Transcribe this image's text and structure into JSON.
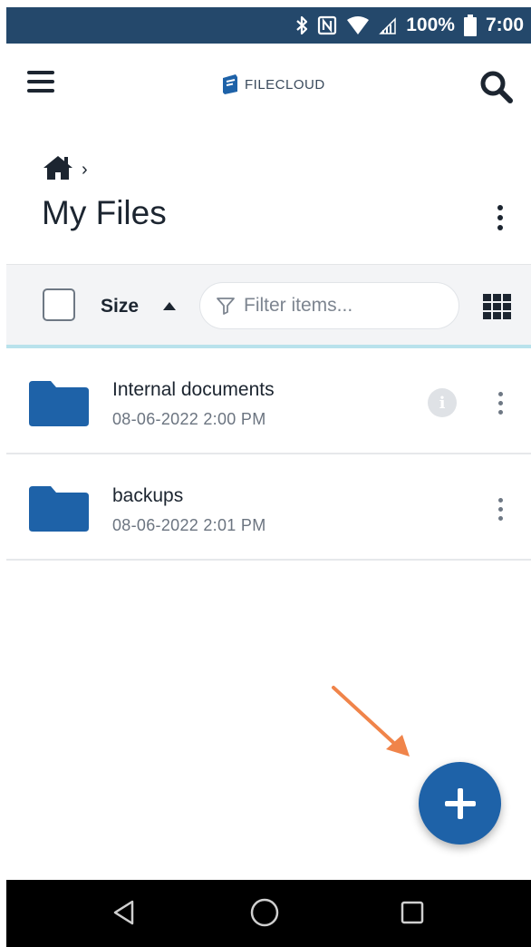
{
  "status_bar": {
    "battery_percent": "100%",
    "time": "7:00",
    "icons": [
      "bluetooth-icon",
      "nfc-icon",
      "wifi-icon",
      "signal-icon",
      "battery-icon"
    ]
  },
  "app_bar": {
    "menu_icon": "hamburger-menu-icon",
    "logo_text": "FILECLOUD",
    "search_icon": "search-icon"
  },
  "breadcrumb": {
    "home_icon": "home-icon",
    "separator": "›"
  },
  "page": {
    "title": "My Files"
  },
  "toolbar": {
    "sort_label": "Size",
    "sort_direction": "ascending",
    "filter_placeholder": "Filter items...",
    "filter_value": "",
    "view_icon": "grid-view-icon"
  },
  "files": [
    {
      "name": "Internal documents",
      "date": "08-06-2022 2:00 PM",
      "type": "folder",
      "has_info": true
    },
    {
      "name": "backups",
      "date": "08-06-2022 2:01 PM",
      "type": "folder",
      "has_info": false
    }
  ],
  "fab": {
    "icon": "plus-icon"
  },
  "navigation_bar": {
    "buttons": [
      "back-icon",
      "home-circle-icon",
      "recents-icon"
    ]
  },
  "colors": {
    "status_bar": "#24486b",
    "accent_blue": "#1e62a8",
    "folder_blue": "#1e62a8",
    "annotation_arrow": "#f0844a",
    "toolbar_background": "#f3f4f6",
    "toolbar_underline": "#b9e2ec"
  }
}
